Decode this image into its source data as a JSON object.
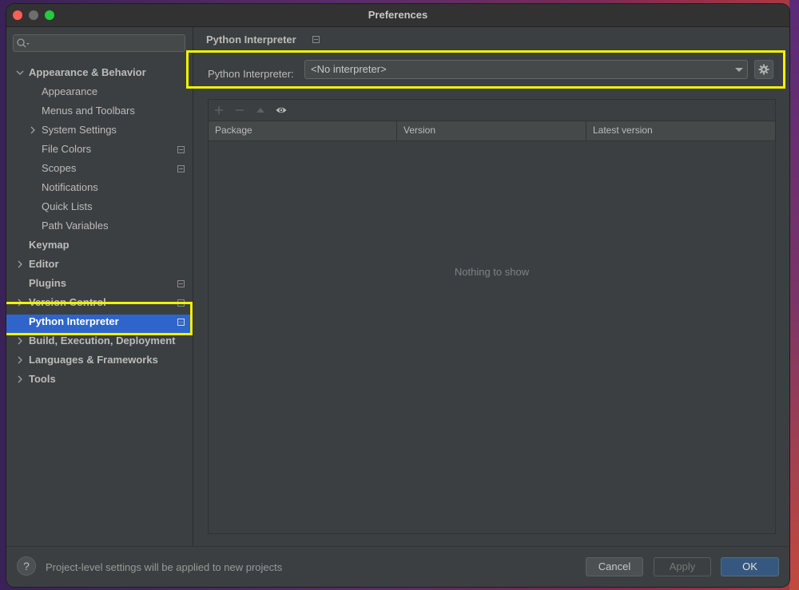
{
  "window": {
    "title": "Preferences"
  },
  "sidebar": {
    "search_placeholder": "",
    "items": [
      {
        "label": "Appearance & Behavior",
        "level": 0,
        "bold": true,
        "expandable": true,
        "expanded": true,
        "icon": false
      },
      {
        "label": "Appearance",
        "level": 1,
        "bold": false,
        "expandable": false,
        "icon": false
      },
      {
        "label": "Menus and Toolbars",
        "level": 1,
        "bold": false,
        "expandable": false,
        "icon": false
      },
      {
        "label": "System Settings",
        "level": 1,
        "bold": false,
        "expandable": true,
        "expanded": false,
        "icon": false
      },
      {
        "label": "File Colors",
        "level": 1,
        "bold": false,
        "expandable": false,
        "icon": true
      },
      {
        "label": "Scopes",
        "level": 1,
        "bold": false,
        "expandable": false,
        "icon": true
      },
      {
        "label": "Notifications",
        "level": 1,
        "bold": false,
        "expandable": false,
        "icon": false
      },
      {
        "label": "Quick Lists",
        "level": 1,
        "bold": false,
        "expandable": false,
        "icon": false
      },
      {
        "label": "Path Variables",
        "level": 1,
        "bold": false,
        "expandable": false,
        "icon": false
      },
      {
        "label": "Keymap",
        "level": 0,
        "bold": true,
        "expandable": false,
        "icon": false
      },
      {
        "label": "Editor",
        "level": 0,
        "bold": true,
        "expandable": true,
        "expanded": false,
        "icon": false
      },
      {
        "label": "Plugins",
        "level": 0,
        "bold": true,
        "expandable": false,
        "icon": true
      },
      {
        "label": "Version Control",
        "level": 0,
        "bold": true,
        "expandable": true,
        "expanded": false,
        "icon": true
      },
      {
        "label": "Python Interpreter",
        "level": 0,
        "bold": true,
        "expandable": false,
        "icon": true,
        "selected": true
      },
      {
        "label": "Build, Execution, Deployment",
        "level": 0,
        "bold": true,
        "expandable": true,
        "expanded": false,
        "icon": false
      },
      {
        "label": "Languages & Frameworks",
        "level": 0,
        "bold": true,
        "expandable": true,
        "expanded": false,
        "icon": false
      },
      {
        "label": "Tools",
        "level": 0,
        "bold": true,
        "expandable": true,
        "expanded": false,
        "icon": false
      }
    ]
  },
  "content": {
    "title": "Python Interpreter",
    "interpreter_label": "Python Interpreter:",
    "interpreter_value": "<No interpreter>",
    "table": {
      "columns": [
        "Package",
        "Version",
        "Latest version"
      ],
      "rows": [],
      "empty_text": "Nothing to show"
    }
  },
  "footer": {
    "help_label": "?",
    "note": "Project-level settings will be applied to new projects",
    "cancel_label": "Cancel",
    "apply_label": "Apply",
    "ok_label": "OK"
  },
  "colors": {
    "selection": "#2f65ca",
    "highlight": "#f5f000",
    "ok_button": "#365880"
  }
}
